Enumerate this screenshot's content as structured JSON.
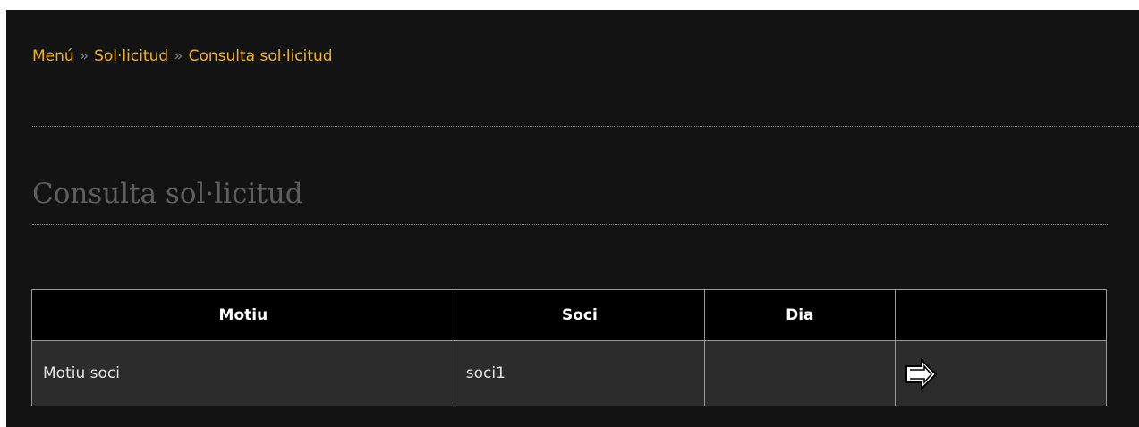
{
  "breadcrumb": {
    "items": [
      "Menú",
      "Sol·licitud",
      "Consulta sol·licitud"
    ],
    "separator": "»"
  },
  "page": {
    "title": "Consulta sol·licitud"
  },
  "table": {
    "headers": [
      "Motiu",
      "Soci",
      "Dia",
      ""
    ],
    "rows": [
      {
        "motiu": "Motiu soci",
        "soci": "soci1",
        "dia": "",
        "action_icon": "arrow-right-icon"
      }
    ]
  },
  "colors": {
    "background": "#131313",
    "link": "#f2b31a",
    "title": "#5e5e5e",
    "header_bg": "#000000",
    "row_bg": "#2c2c2c"
  }
}
